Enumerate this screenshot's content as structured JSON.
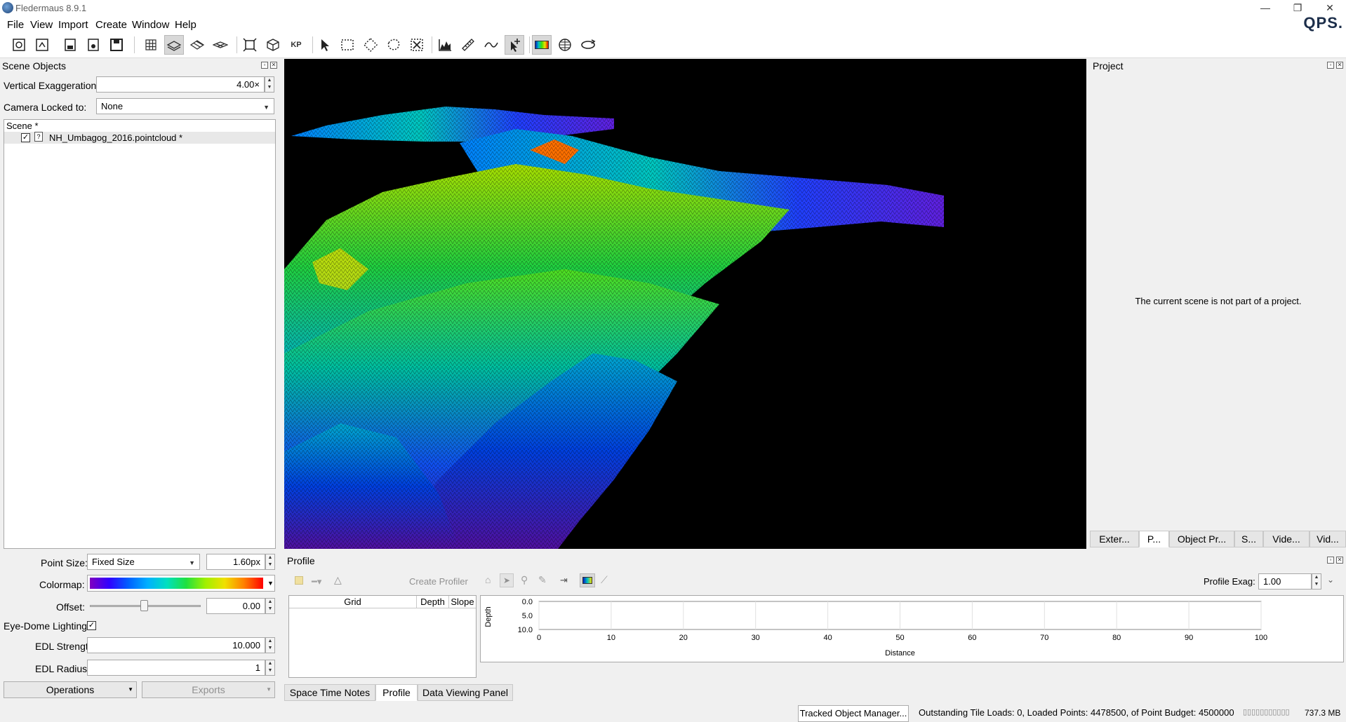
{
  "app": {
    "title": "Fledermaus 8.9.1",
    "logo_text": "QPS."
  },
  "window_controls": {
    "minimize": "—",
    "restore": "❐",
    "close": "✕"
  },
  "menu": [
    "File",
    "View",
    "Import",
    "Create",
    "Window",
    "Help"
  ],
  "toolbar_icons": [
    "new-scene-icon",
    "open-scene-icon",
    "save-scene-icon",
    "save-as-icon",
    "export-icon",
    "grid-icon",
    "surface-layer-icon",
    "surface-flat-icon",
    "surface-mesh-icon",
    "zoom-extents-icon",
    "cube-view-icon",
    "kp-icon",
    "select-arrow-icon",
    "rect-select-icon",
    "polygon-select-icon",
    "lasso-select-icon",
    "clear-selection-icon",
    "profile-chart-icon",
    "measure-ruler-icon",
    "curve-icon",
    "add-point-icon",
    "colormap-icon",
    "sphere-icon",
    "rotate-icon"
  ],
  "scene_objects": {
    "title": "Scene Objects",
    "vertical_exaggeration_label": "Vertical Exaggeration:",
    "vertical_exaggeration_value": "4.00×",
    "camera_locked_label": "Camera Locked to:",
    "camera_locked_value": "None",
    "tree_root": "Scene *",
    "tree_item": "NH_Umbagog_2016.pointcloud *",
    "point_size_label": "Point Size:",
    "point_size_mode": "Fixed Size",
    "point_size_value": "1.60px",
    "colormap_label": "Colormap:",
    "offset_label": "Offset:",
    "offset_value": "0.00",
    "edl_label": "Eye-Dome Lighting:",
    "edl_strength_label": "EDL Strength:",
    "edl_strength_value": "10.000",
    "edl_radius_label": "EDL Radius:",
    "edl_radius_value": "1",
    "operations_label": "Operations",
    "exports_label": "Exports"
  },
  "project": {
    "title": "Project",
    "message": "The current scene is not part of a project.",
    "tabs": [
      "Exter...",
      "P...",
      "Object Pr...",
      "S...",
      "Vide...",
      "Vid..."
    ]
  },
  "profile": {
    "title": "Profile",
    "create_profiler_label": "Create Profiler",
    "profile_exag_label": "Profile Exag:",
    "profile_exag_value": "1.00",
    "table_headers": [
      "Grid",
      "Depth",
      "Slope"
    ]
  },
  "chart_data": {
    "type": "line",
    "title": "",
    "xlabel": "Distance",
    "ylabel": "Depth",
    "x_ticks": [
      "0",
      "10",
      "20",
      "30",
      "40",
      "50",
      "60",
      "70",
      "80",
      "90",
      "100"
    ],
    "y_ticks": [
      "0.0",
      "5.0",
      "10.0"
    ],
    "xlim": [
      0,
      100
    ],
    "ylim": [
      0,
      10
    ],
    "series": []
  },
  "bottom_tabs": [
    "Space Time Notes",
    "Profile",
    "Data Viewing Panel"
  ],
  "status": {
    "tracked_button": "Tracked Object Manager...",
    "tiles_text": "Outstanding Tile Loads: 0, Loaded Points: 4478500, of Point Budget: 4500000",
    "memory_bar": "▯▯▯▯▯▯▯▯▯▯▯",
    "memory": "737.3 MB"
  },
  "colors": {
    "viewport_bg": "#000000",
    "accent": "#1c2e4a"
  }
}
